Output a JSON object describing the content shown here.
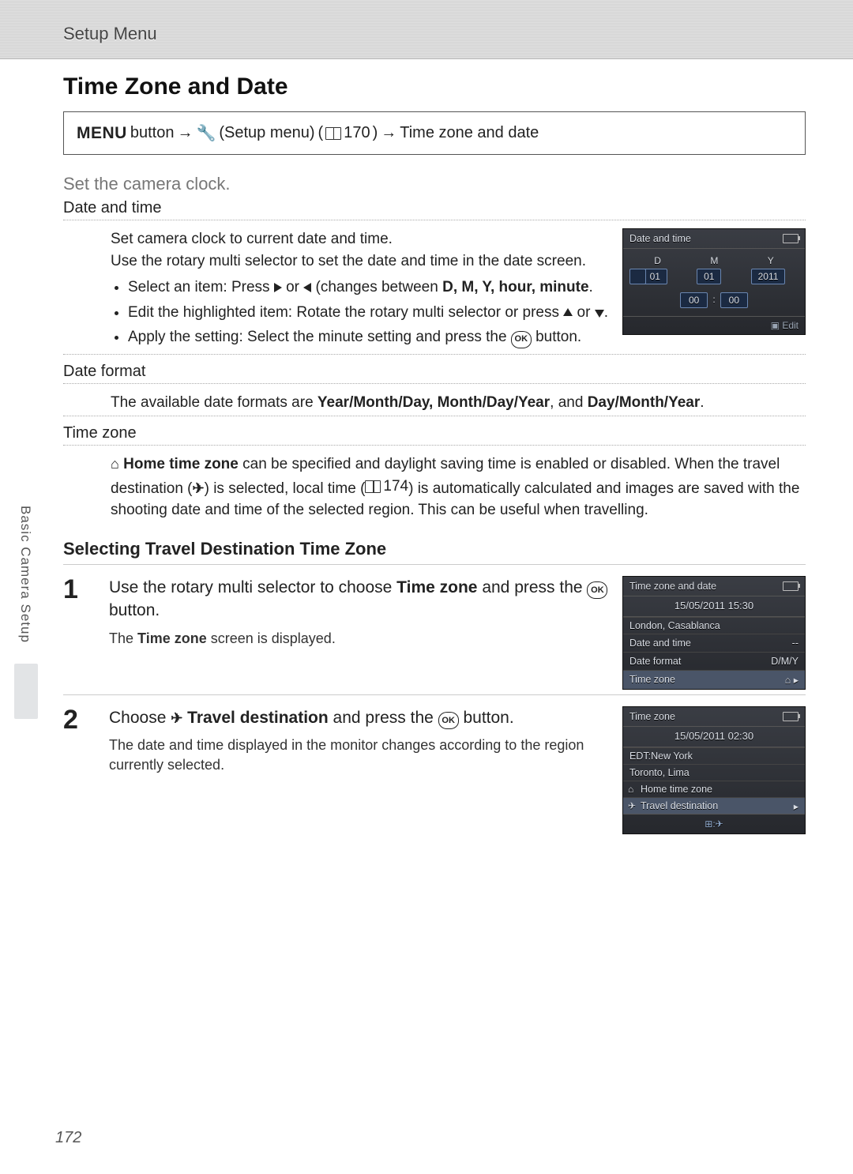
{
  "header": {
    "chapter": "Setup Menu"
  },
  "title": "Time Zone and Date",
  "nav": {
    "menu": "MENU",
    "btn_word": "button",
    "setup_menu": "(Setup menu)",
    "ref": "170",
    "dest": "Time zone and date"
  },
  "lead": "Set the camera clock.",
  "date_time": {
    "label": "Date and time",
    "p1": "Set camera clock to current date and time.",
    "p2": "Use the rotary multi selector to set the date and time in the date screen.",
    "b1_a": "Select an item: Press ",
    "b1_b": " or ",
    "b1_c": " (changes between ",
    "b1_items": "D, M, Y, hour, minute",
    "b1_d": ".",
    "b2_a": "Edit the highlighted item: Rotate the rotary multi selector or press ",
    "b2_b": " or ",
    "b2_c": ".",
    "b3_a": "Apply the setting: Select the minute setting and press the ",
    "b3_b": " button."
  },
  "date_format": {
    "label": "Date format",
    "text_a": "The available date formats are ",
    "opts": "Year/Month/Day, Month/Day/Year",
    "text_b": ", and ",
    "opt_last": "Day/Month/Year",
    "text_c": "."
  },
  "timezone": {
    "label": "Time zone",
    "text_a": "Home time zone",
    "text_b": " can be specified and daylight saving time is enabled or disabled. When the travel destination (",
    "text_c": ") is selected, local time (",
    "ref": "174",
    "text_d": ") is automatically calculated and images are saved with the shooting date and time of the selected region. This can be useful when travelling."
  },
  "subheading": "Selecting Travel Destination Time Zone",
  "step1": {
    "num": "1",
    "line_a": "Use the rotary multi selector to choose ",
    "bold": "Time zone",
    "line_b": " and press the ",
    "line_c": " button.",
    "note_a": "The ",
    "note_bold": "Time zone",
    "note_b": " screen is displayed."
  },
  "step2": {
    "num": "2",
    "line_a": "Choose ",
    "bold": "Travel destination",
    "line_b": " and press the ",
    "line_c": " button.",
    "note": "The date and time displayed in the monitor changes according to the region currently selected."
  },
  "cam1": {
    "title": "Date and time",
    "D": "D",
    "M": "M",
    "Y": "Y",
    "d": "01",
    "m": "01",
    "y": "2011",
    "h": "00",
    "mm": "00",
    "edit": "Edit"
  },
  "cam2": {
    "title": "Time zone and date",
    "datetime": "15/05/2011 15:30",
    "city": "London, Casablanca",
    "row1": "Date and time",
    "row2": "Date format",
    "row2v": "D/M/Y",
    "row3": "Time zone"
  },
  "cam3": {
    "title": "Time zone",
    "datetime": "15/05/2011 02:30",
    "city1": "EDT:New York",
    "city2": "Toronto, Lima",
    "opt1": "Home time zone",
    "opt2": "Travel destination",
    "footer": "⊞:"
  },
  "side_label": "Basic Camera Setup",
  "page_number": "172",
  "ok_label": "OK"
}
